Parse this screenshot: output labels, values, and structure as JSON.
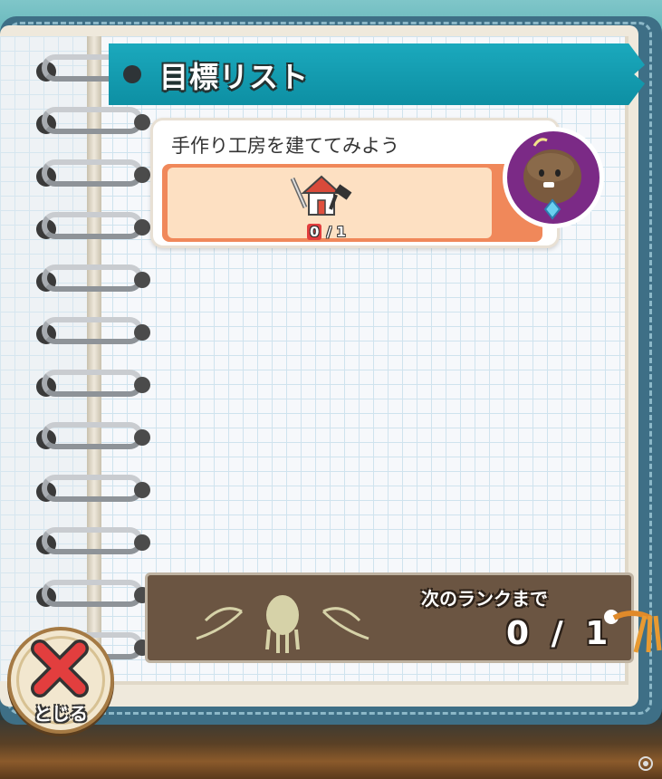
{
  "header": {
    "title": "目標リスト"
  },
  "goals": [
    {
      "text": "手作り工房を建ててみよう",
      "icon": "workshop-house-icon",
      "progress_current": "0",
      "progress_sep": "/",
      "progress_total": "1"
    }
  ],
  "rank": {
    "label": "次のランクまで",
    "value": "0 / 1"
  },
  "close_button": {
    "label": "とじる",
    "icon": "close-x-icon"
  },
  "colors": {
    "banner": "#1ba9bd",
    "card_accent": "#f0885a",
    "card_light": "#fde0c2",
    "rank_panel": "#6b5542",
    "close_red": "#e23e3e"
  }
}
